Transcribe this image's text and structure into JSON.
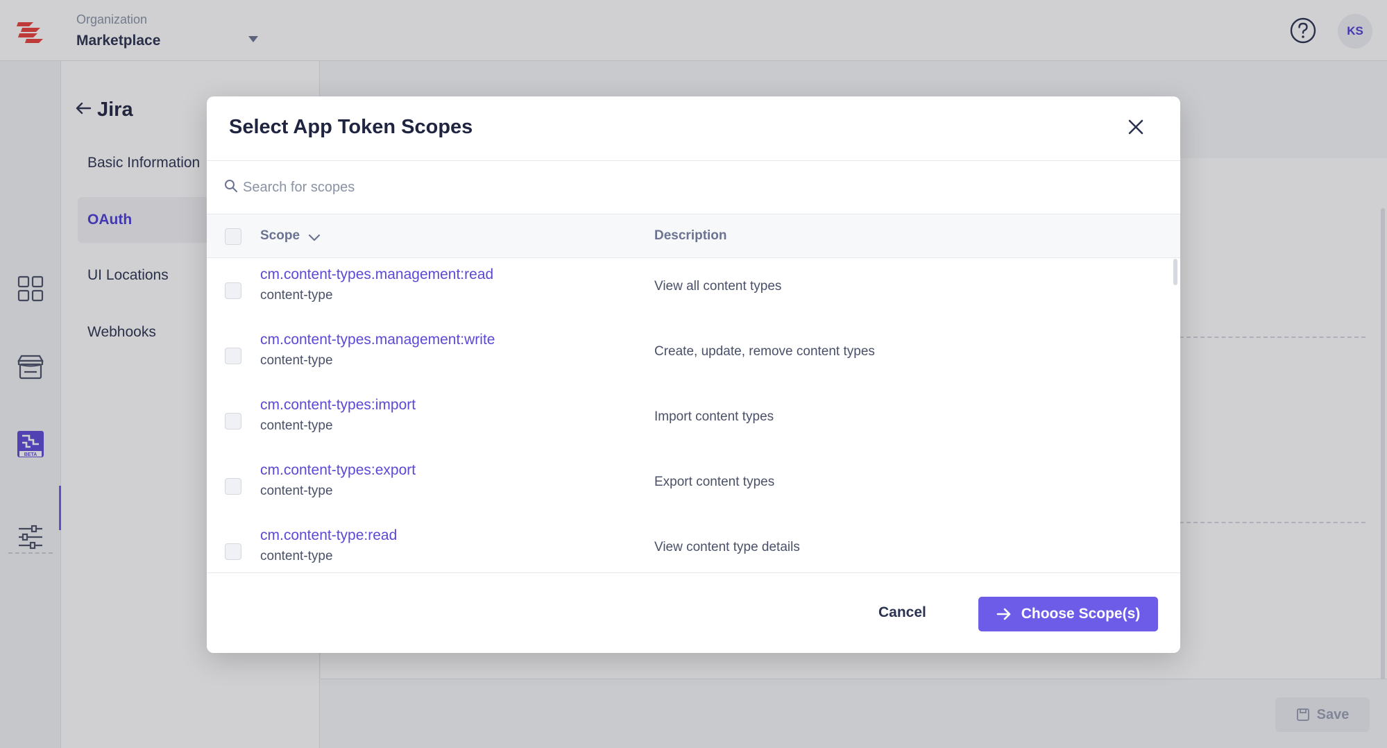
{
  "topbar": {
    "org_label": "Organization",
    "org_name": "Marketplace",
    "avatar_initials": "KS",
    "brand_color": "#e8413c"
  },
  "rail": {
    "icons": [
      "dashboard-icon",
      "marketplace-store-icon",
      "developer-hub-icon",
      "settings-sliders-icon"
    ],
    "beta_badge": "BETA",
    "active_color": "#6c5ce7"
  },
  "app": {
    "title": "Jira",
    "nav": [
      {
        "label": "Basic Information",
        "active": false
      },
      {
        "label": "OAuth",
        "active": true
      },
      {
        "label": "UI Locations",
        "active": false
      },
      {
        "label": "Webhooks",
        "active": false
      }
    ]
  },
  "footer": {
    "save_label": "Save"
  },
  "modal": {
    "title": "Select App Token Scopes",
    "search_placeholder": "Search for scopes",
    "columns": {
      "scope": "Scope",
      "description": "Description"
    },
    "rows": [
      {
        "scope": "cm.content-types.management:read",
        "group": "content-type",
        "description": "View all content types"
      },
      {
        "scope": "cm.content-types.management:write",
        "group": "content-type",
        "description": "Create, update, remove content types"
      },
      {
        "scope": "cm.content-types:import",
        "group": "content-type",
        "description": "Import content types"
      },
      {
        "scope": "cm.content-types:export",
        "group": "content-type",
        "description": "Export content types"
      },
      {
        "scope": "cm.content-type:read",
        "group": "content-type",
        "description": "View content type details"
      }
    ],
    "cancel_label": "Cancel",
    "choose_label": "Choose Scope(s)",
    "accent_color": "#6c5ce7"
  }
}
